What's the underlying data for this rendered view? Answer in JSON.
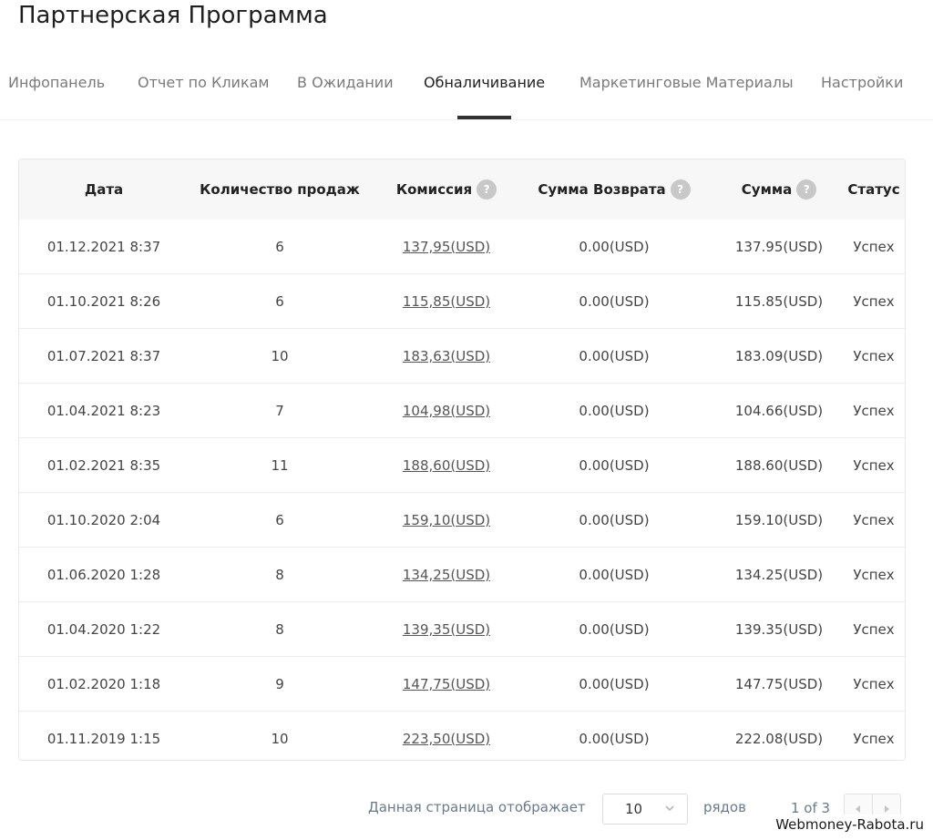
{
  "header": {
    "title": "Партнерская Программа"
  },
  "tabs": [
    {
      "label": "Инфопанель",
      "active": false
    },
    {
      "label": "Отчет по Кликам",
      "active": false
    },
    {
      "label": "В Ожидании",
      "active": false
    },
    {
      "label": "Обналичивание",
      "active": true
    },
    {
      "label": "Маркетинговые Материалы",
      "active": false
    },
    {
      "label": "Настройки",
      "active": false
    }
  ],
  "table": {
    "columns": {
      "date": "Дата",
      "sales": "Количество продаж",
      "commission": "Комиссия",
      "refund": "Сумма Возврата",
      "amount": "Сумма",
      "status": "Статус",
      "help_mark": "?"
    },
    "rows": [
      {
        "date": "01.12.2021 8:37",
        "sales": "6",
        "commission": "137,95(USD)",
        "refund": "0.00(USD)",
        "amount": "137.95(USD)",
        "status": "Успех"
      },
      {
        "date": "01.10.2021 8:26",
        "sales": "6",
        "commission": "115,85(USD)",
        "refund": "0.00(USD)",
        "amount": "115.85(USD)",
        "status": "Успех"
      },
      {
        "date": "01.07.2021 8:37",
        "sales": "10",
        "commission": "183,63(USD)",
        "refund": "0.00(USD)",
        "amount": "183.09(USD)",
        "status": "Успех"
      },
      {
        "date": "01.04.2021 8:23",
        "sales": "7",
        "commission": "104,98(USD)",
        "refund": "0.00(USD)",
        "amount": "104.66(USD)",
        "status": "Успех"
      },
      {
        "date": "01.02.2021 8:35",
        "sales": "11",
        "commission": "188,60(USD)",
        "refund": "0.00(USD)",
        "amount": "188.60(USD)",
        "status": "Успех"
      },
      {
        "date": "01.10.2020 2:04",
        "sales": "6",
        "commission": "159,10(USD)",
        "refund": "0.00(USD)",
        "amount": "159.10(USD)",
        "status": "Успех"
      },
      {
        "date": "01.06.2020 1:28",
        "sales": "8",
        "commission": "134,25(USD)",
        "refund": "0.00(USD)",
        "amount": "134.25(USD)",
        "status": "Успех"
      },
      {
        "date": "01.04.2020 1:22",
        "sales": "8",
        "commission": "139,35(USD)",
        "refund": "0.00(USD)",
        "amount": "139.35(USD)",
        "status": "Успех"
      },
      {
        "date": "01.02.2020 1:18",
        "sales": "9",
        "commission": "147,75(USD)",
        "refund": "0.00(USD)",
        "amount": "147.75(USD)",
        "status": "Успех"
      },
      {
        "date": "01.11.2019 1:15",
        "sales": "10",
        "commission": "223,50(USD)",
        "refund": "0.00(USD)",
        "amount": "222.08(USD)",
        "status": "Успех"
      }
    ]
  },
  "pagination": {
    "label": "Данная страница отображает",
    "rows_value": "10",
    "rows_label": "рядов",
    "page_info": "1 of 3"
  },
  "icons": {
    "help": "question-icon",
    "select": "chevron-down-icon",
    "prev": "chevron-left-icon",
    "next": "chevron-right-icon"
  },
  "colors": {
    "active_tab_underline": "#333333",
    "header_bg": "#f7f7f7",
    "help_badge": "#c8c8c8"
  },
  "watermark": "Webmoney-Rabota.ru"
}
